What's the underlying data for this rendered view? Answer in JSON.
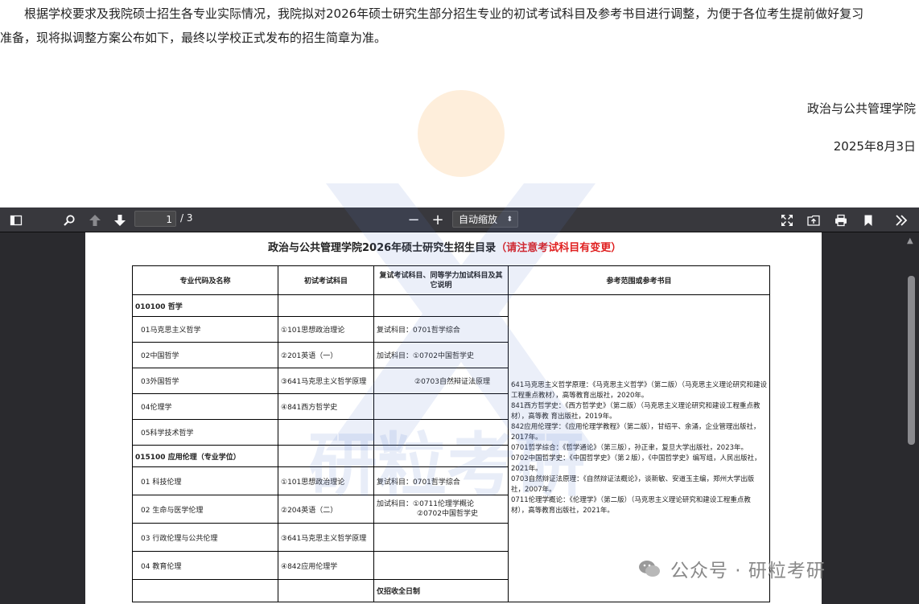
{
  "intro": {
    "line1": "根据学校要求及我院硕士招生各专业实际情况，我院拟对2026年硕士研究生部分招生专业的初试考试科目及参考书目进行调整，为便于各位考生提前做好复习",
    "line2": "准备，现将拟调整方案公布如下，最终以学校正式发布的招生简章为准。",
    "org": "政治与公共管理学院",
    "date": "2025年8月3日"
  },
  "toolbar": {
    "page_current": "1",
    "page_total": "/ 3",
    "zoom_label": "自动缩放",
    "zoom_out": "−",
    "zoom_in": "+"
  },
  "document": {
    "title_main": "政治与公共管理学院2026年硕士研究生招生目录",
    "title_note": "（请注意考试科目有变更）",
    "headers": [
      "专业代码及名称",
      "初试考试科目",
      "复试考试科目、同等学力加试科目及其它说明",
      "参考范围或参考书目"
    ],
    "rows": [
      {
        "major": "010100 哲学",
        "exam": "",
        "retest": "",
        "bold": true
      },
      {
        "major": "01马克思主义哲学",
        "exam": "①101思想政治理论",
        "retest": "复试科目：0701哲学综合"
      },
      {
        "major": "02中国哲学",
        "exam": "②201英语（一）",
        "retest": "加试科目：①0702中国哲学史"
      },
      {
        "major": "03外国哲学",
        "exam": "③641马克思主义哲学原理",
        "retest": "②0703自然辩证法原理"
      },
      {
        "major": "04伦理学",
        "exam": "④841西方哲学史",
        "retest": ""
      },
      {
        "major": "05科学技术哲学",
        "exam": "",
        "retest": ""
      },
      {
        "major": "015100 应用伦理（专业学位）",
        "exam": "",
        "retest": "",
        "bold": true
      },
      {
        "major": "01 科技伦理",
        "exam": "①101思想政治理论",
        "retest": "复试科目：0701哲学综合"
      },
      {
        "major": "02 生命与医学伦理",
        "exam": "②204英语（二）",
        "retest": "加试科目：①0711伦理学概论"
      },
      {
        "major": "03 行政伦理与公共伦理",
        "exam": "③641马克思主义哲学原理",
        "retest": ""
      },
      {
        "major": "04 教育伦理",
        "exam": "④842应用伦理学",
        "retest": ""
      },
      {
        "major": "",
        "exam": "",
        "retest": "仅招收全日制"
      }
    ],
    "retest_extra": "②0702中国哲学史",
    "references": [
      "641马克思主义哲学原理：《马克思主义哲学》（第二版）（马克思主义理论研究和建设工程重点教材），高等教育出版社，2020年。",
      "841西方哲学史：《西方哲学史》（第二版）（马克思主义理论研究和建设工程重点教材），高等教 育出版社，2019年。",
      "842应用伦理学：《应用伦理学教程》（第二版），甘绍平、余涌，企业管理出版社，2017年。",
      "0701哲学综合：《哲学通论》（第三版），孙正聿，复旦大学出版社，2023年。",
      "0702中国哲学史：《中国哲学史》（第２版），《中国哲学史》编写组，人民出版社，2021年。",
      "0703自然辩证法原理：《自然辩证法概论》，谈新敏、安道玉主编，郑州大学出版社，2007年。",
      "0711伦理学概论：《伦理学》（第二版）（马克思主义理论研究和建设工程重点教材），高等教育出版社，2021年。"
    ]
  },
  "watermark": {
    "text": "研粒考研"
  },
  "badge": {
    "text": "公众号 · 研粒考研"
  },
  "colors": {
    "toolbar_bg": "#38383d",
    "viewer_bg": "#2a2a2e",
    "accent_red": "#e02020"
  }
}
